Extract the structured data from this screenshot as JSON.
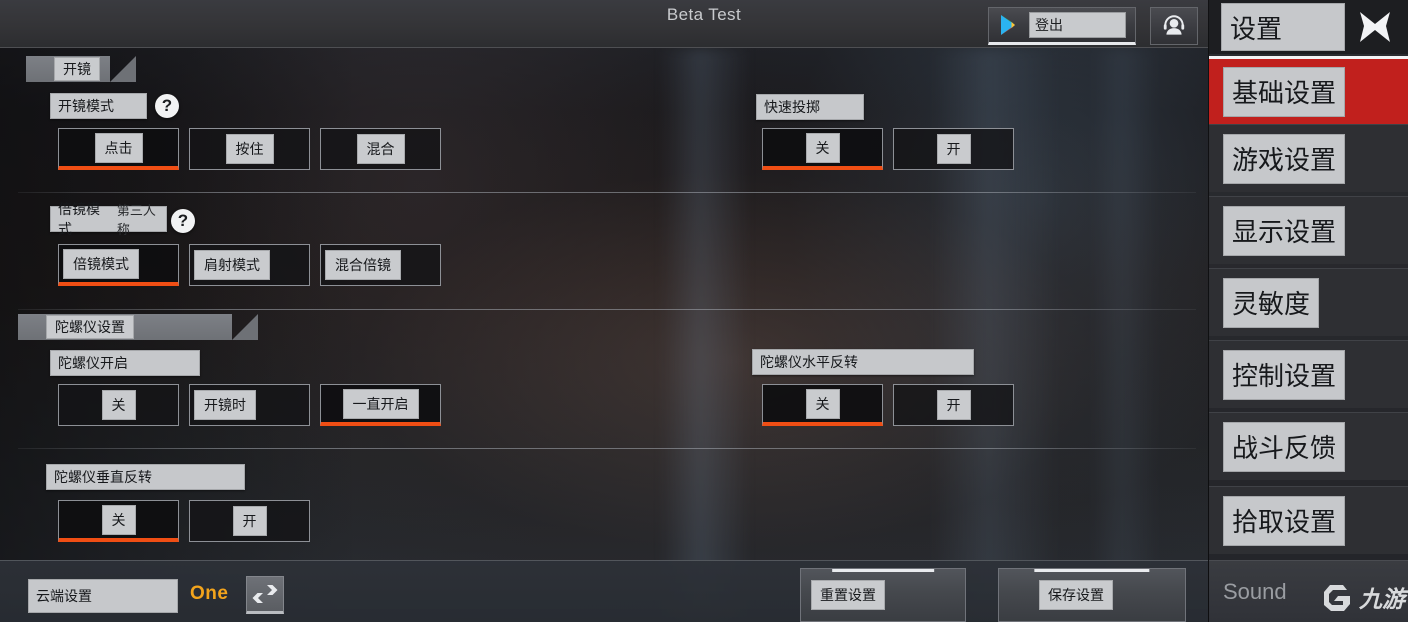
{
  "header": {
    "title": "Beta Test",
    "account_button": {
      "label": "登出",
      "icon": "google-play-icon"
    },
    "support_button": {
      "icon": "headset-support-icon"
    }
  },
  "sections": [
    {
      "id": "scope",
      "tab_label": "开镜",
      "rows": [
        {
          "id": "scope-mode",
          "label": "开镜模式",
          "sub": "",
          "help": "?",
          "options": [
            {
              "label": "点击",
              "selected": true
            },
            {
              "label": "按住",
              "selected": false
            },
            {
              "label": "混合",
              "selected": false
            }
          ]
        },
        {
          "id": "quick-throw",
          "label": "快速投掷",
          "sub": "",
          "help": "",
          "options": [
            {
              "label": "关",
              "selected": true
            },
            {
              "label": "开",
              "selected": false
            }
          ]
        },
        {
          "id": "magnify-mode",
          "label": "倍镜模式",
          "sub": "第三人称",
          "help": "?",
          "options": [
            {
              "label": "倍镜模式",
              "selected": true
            },
            {
              "label": "肩射模式",
              "selected": false
            },
            {
              "label": "混合倍镜",
              "selected": false
            }
          ]
        }
      ]
    },
    {
      "id": "gyro",
      "tab_label": "陀螺仪设置",
      "rows": [
        {
          "id": "gyro-enable",
          "label": "陀螺仪开启",
          "sub": "",
          "help": "",
          "options": [
            {
              "label": "关",
              "selected": false
            },
            {
              "label": "开镜时",
              "selected": false
            },
            {
              "label": "一直开启",
              "selected": true
            }
          ]
        },
        {
          "id": "gyro-horizontal-invert",
          "label": "陀螺仪水平反转",
          "sub": "",
          "help": "",
          "options": [
            {
              "label": "关",
              "selected": true
            },
            {
              "label": "开",
              "selected": false
            }
          ]
        },
        {
          "id": "gyro-vertical-invert",
          "label": "陀螺仪垂直反转",
          "sub": "",
          "help": "",
          "options": [
            {
              "label": "关",
              "selected": true
            },
            {
              "label": "开",
              "selected": false
            }
          ]
        }
      ]
    }
  ],
  "bottom": {
    "cloud_label": "云端设置",
    "cloud_value": "One",
    "swap_icon": "swap-arrows-icon",
    "reset_label": "重置设置",
    "save_label": "保存设置"
  },
  "sidebar": {
    "title": "设置",
    "close_icon": "close-x-icon",
    "items": [
      {
        "label": "基础设置",
        "active": true
      },
      {
        "label": "游戏设置",
        "active": false
      },
      {
        "label": "显示设置",
        "active": false
      },
      {
        "label": "灵敏度",
        "active": false
      },
      {
        "label": "控制设置",
        "active": false
      },
      {
        "label": "战斗反馈",
        "active": false
      },
      {
        "label": "拾取设置",
        "active": false
      }
    ],
    "footer_text": "Sound",
    "watermark_text": "九游"
  },
  "colors": {
    "accent_orange": "#f04e14",
    "active_red": "#c1201d",
    "chip_gray": "#c6c8cb",
    "value_gold": "#f3a41c"
  }
}
